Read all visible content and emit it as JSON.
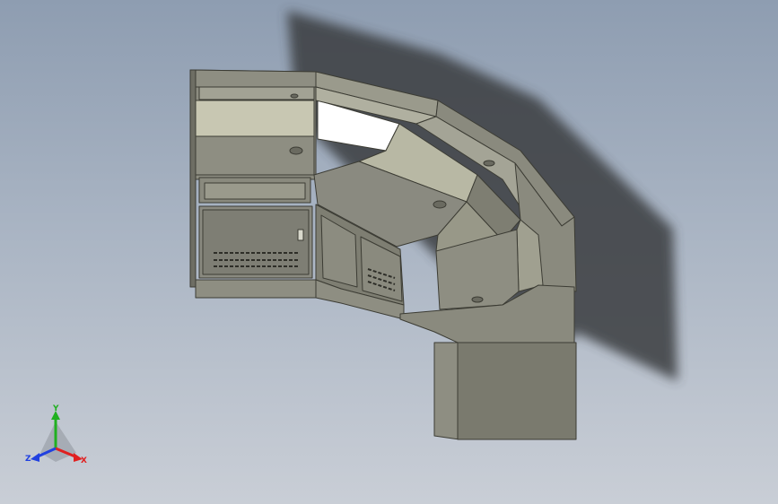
{
  "viewport": {
    "background_top": "#8e9db1",
    "background_bottom": "#c9ced6",
    "model_name": "console-desk-model"
  },
  "triad": {
    "x_label": "X",
    "y_label": "Y",
    "z_label": "Z",
    "x_color": "#e02020",
    "y_color": "#20b020",
    "z_color": "#2040e0"
  },
  "colors": {
    "panel_light": "#c8c7b2",
    "panel_mid": "#a8a898",
    "panel_dark": "#7a7a6e",
    "shadow": "#3a3d40",
    "outline": "#3c3c34"
  }
}
